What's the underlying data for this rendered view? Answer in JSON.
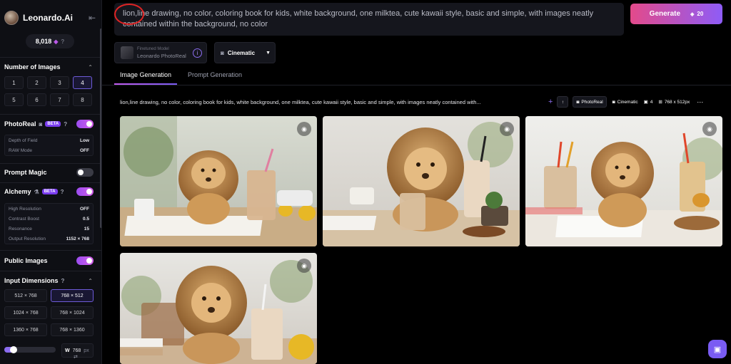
{
  "sidebar": {
    "logo_text": "Leonardo.Ai",
    "credits": "8,018",
    "sections": {
      "num_images": "Number of Images",
      "photoreal": "PhotoReal",
      "prompt_magic": "Prompt Magic",
      "alchemy": "Alchemy",
      "public_images": "Public Images",
      "input_dimensions": "Input Dimensions"
    },
    "beta_label": "BETA",
    "number_options": [
      "1",
      "2",
      "3",
      "4",
      "5",
      "6",
      "7",
      "8"
    ],
    "selected_number": "4",
    "photoreal_settings": [
      {
        "label": "Depth of Field",
        "value": "Low"
      },
      {
        "label": "RAW Mode",
        "value": "OFF"
      }
    ],
    "alchemy_settings": [
      {
        "label": "High Resolution",
        "value": "OFF"
      },
      {
        "label": "Contrast Boost",
        "value": "0.5"
      },
      {
        "label": "Resonance",
        "value": "15"
      },
      {
        "label": "Output Resolution",
        "value": "1152 × 768"
      }
    ],
    "toggles": {
      "photoreal": true,
      "prompt_magic": false,
      "alchemy": true,
      "public_images": true
    },
    "dimension_options": [
      "512 × 768",
      "768 × 512",
      "1024 × 768",
      "768 × 1024",
      "1360 × 768",
      "768 × 1360"
    ],
    "selected_dimension": "768 × 512",
    "width_label": "W",
    "width_value": "768",
    "width_unit": "px",
    "width_slider_fraction": 0.18
  },
  "main": {
    "prompt_text": "lion,line drawing, no color, coloring book for kids, white background, one milktea, cute kawaii style, basic and simple, with images neatly contained within the background, no color",
    "generate_label": "Generate",
    "generate_cost": "20",
    "model_caption": "Finetuned Model",
    "model_name": "Leonardo PhotoReal",
    "style_label": "Cinematic",
    "tabs": [
      "Image Generation",
      "Prompt Generation"
    ],
    "generation": {
      "prompt": "lion,line drawing, no color, coloring book for kids, white background, one milktea, cute kawaii style, basic and simple, with images neatly contained with...",
      "model_chip": "PhotoReal",
      "style_chip": "Cinematic",
      "count": "4",
      "size": "768 x 512px"
    },
    "images": [
      {
        "alt": "lion with milk tea on table"
      },
      {
        "alt": "lion with iced latte and plant"
      },
      {
        "alt": "lion with milk tea and straws"
      },
      {
        "alt": "lion with milkshake and lemon"
      }
    ]
  }
}
